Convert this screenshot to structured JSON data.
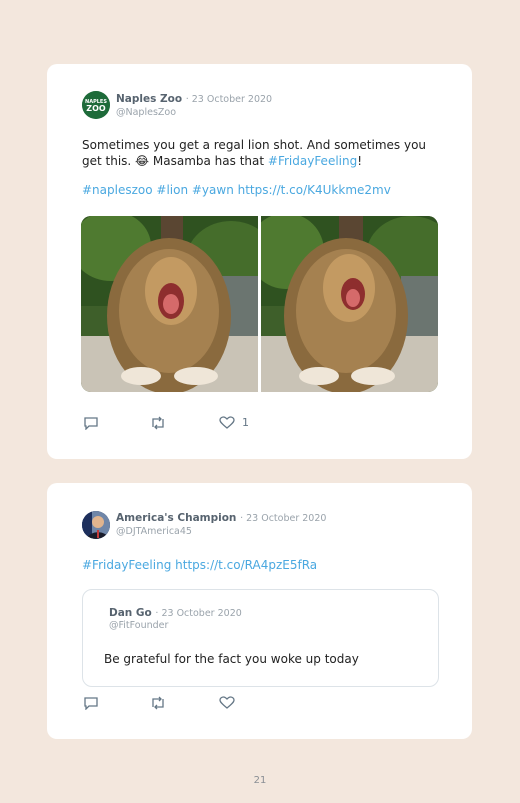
{
  "tweet1": {
    "name": "Naples Zoo",
    "date": "· 23 October 2020",
    "handle": "@NaplesZoo",
    "avatar_text": "NAPLES ZOO",
    "line1": "Sometimes you get a regal lion shot. And sometimes you",
    "line2_pre": "get this. 😂 Masamba has that ",
    "line2_link": "#FridayFeeling",
    "line2_post": "!",
    "hashtags_line": "#napleszoo #lion #yawn https://t.co/K4Ukkme2mv",
    "like_count": "1"
  },
  "tweet2": {
    "name": "America's Champion",
    "date": "· 23 October 2020",
    "handle": "@DJTAmerica45",
    "text": "#FridayFeeling https://t.co/RA4pzE5fRa",
    "quote": {
      "name": "Dan Go",
      "date": "· 23 October 2020",
      "handle": "@FitFounder",
      "text": "Be grateful for the fact you woke up today"
    }
  },
  "page_number": "21",
  "colors": {
    "background": "#f3e7dd",
    "link": "#4aa8e0",
    "zoo_green": "#1e6b3a"
  }
}
